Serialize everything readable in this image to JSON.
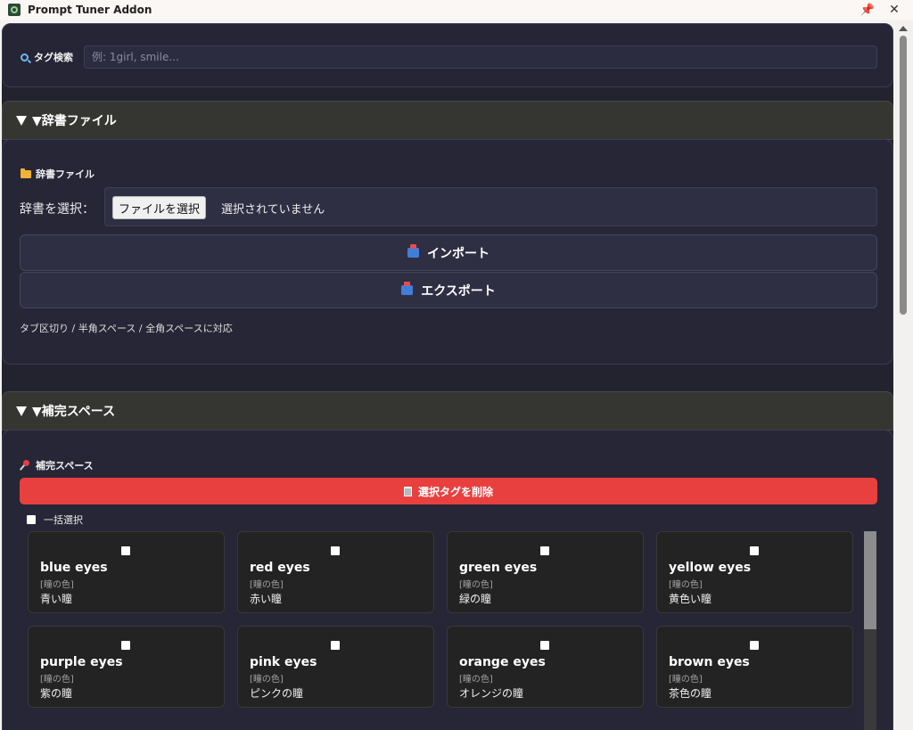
{
  "window": {
    "title": "Prompt Tuner Addon",
    "pin_glyph": "📌",
    "close_glyph": "✕"
  },
  "search": {
    "label": "タグ検索",
    "placeholder": "例: 1girl, smile..."
  },
  "dictionary": {
    "header": "▼辞書ファイル",
    "title": "辞書ファイル",
    "select_label": "辞書を選択：",
    "file_button": "ファイルを選択",
    "file_status": "選択されていません",
    "import_label": "インポート",
    "export_label": "エクスポート",
    "note": "タブ区切り / 半角スペース / 全角スペースに対応"
  },
  "completion": {
    "header": "▼補完スペース",
    "title": "補完スペース",
    "delete_button": "選択タグを削除",
    "select_all": "一括選択",
    "cards": [
      {
        "name": "blue eyes",
        "category": "[瞳の色]",
        "jp": "青い瞳"
      },
      {
        "name": "red eyes",
        "category": "[瞳の色]",
        "jp": "赤い瞳"
      },
      {
        "name": "green eyes",
        "category": "[瞳の色]",
        "jp": "緑の瞳"
      },
      {
        "name": "yellow eyes",
        "category": "[瞳の色]",
        "jp": "黄色い瞳"
      },
      {
        "name": "purple eyes",
        "category": "[瞳の色]",
        "jp": "紫の瞳"
      },
      {
        "name": "pink eyes",
        "category": "[瞳の色]",
        "jp": "ピンクの瞳"
      },
      {
        "name": "orange eyes",
        "category": "[瞳の色]",
        "jp": "オレンジの瞳"
      },
      {
        "name": "brown eyes",
        "category": "[瞳の色]",
        "jp": "茶色の瞳"
      }
    ]
  },
  "colors": {
    "app_bg": "#232330",
    "panel_bg": "#262637",
    "section_header_bg": "#353532",
    "delete_red": "#e8403f",
    "card_bg": "#232323"
  },
  "icons": {
    "search": "magnifier-icon",
    "dictionary": "folder-icon",
    "import": "inbox-tray-icon",
    "export": "outbox-tray-icon",
    "completion": "pushpin-icon",
    "delete": "wastebasket-icon"
  }
}
